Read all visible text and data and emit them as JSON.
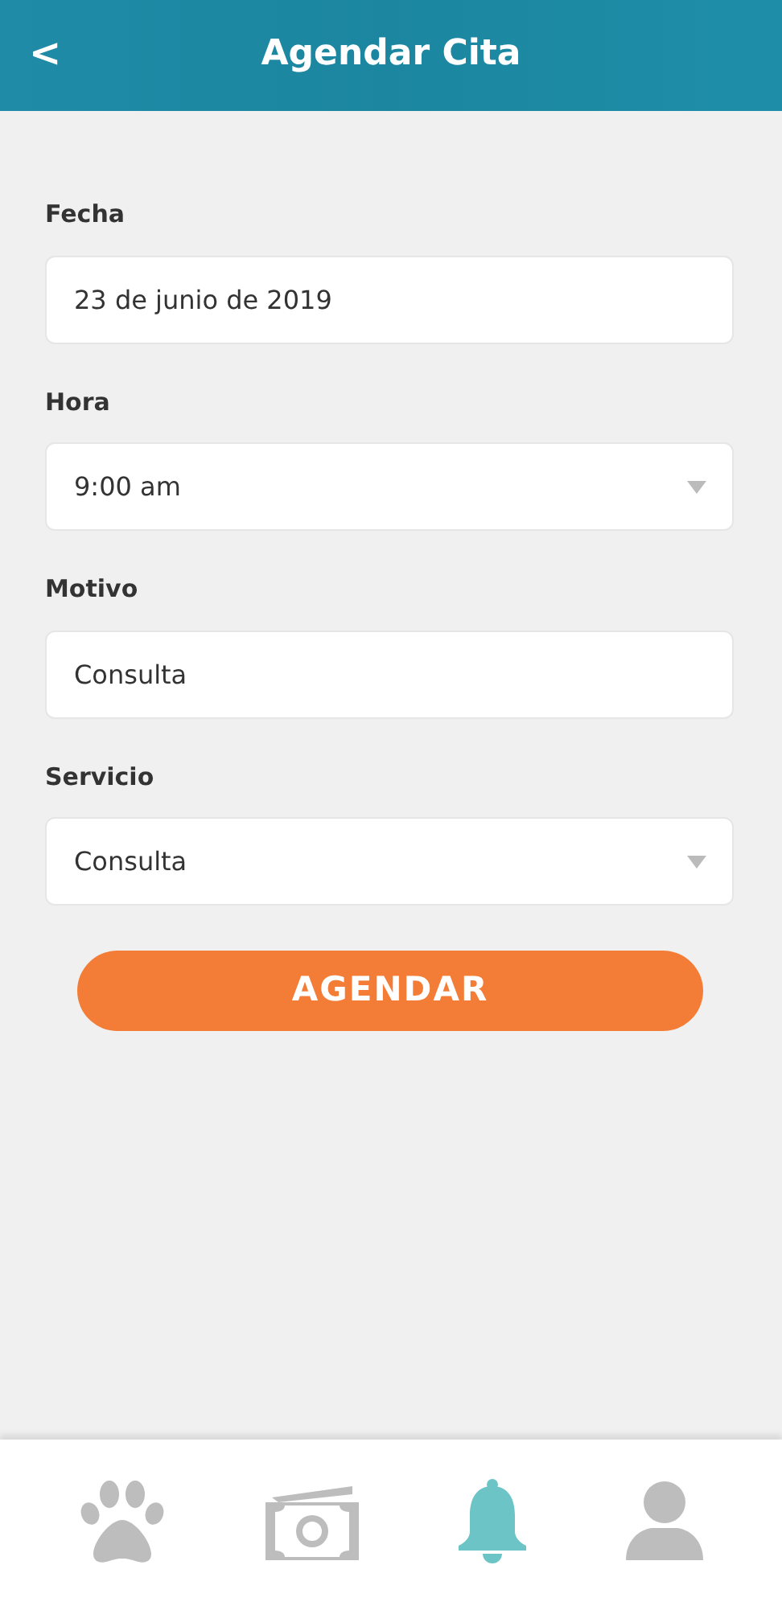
{
  "header": {
    "back": "<",
    "title": "Agendar Cita"
  },
  "fields": [
    {
      "label": "Fecha",
      "kind": "input",
      "value": "23 de junio de 2019"
    },
    {
      "label": "Hora",
      "kind": "select",
      "value": "9:00 am"
    },
    {
      "label": "Motivo",
      "kind": "input",
      "value": "Consulta"
    },
    {
      "label": "Servicio",
      "kind": "select",
      "value": "Consulta"
    }
  ],
  "submit": "AGENDAR",
  "tabs": [
    {
      "kind": "paw",
      "selected": false
    },
    {
      "kind": "money",
      "selected": false
    },
    {
      "kind": "bell",
      "selected": true
    },
    {
      "kind": "person",
      "selected": false
    }
  ]
}
